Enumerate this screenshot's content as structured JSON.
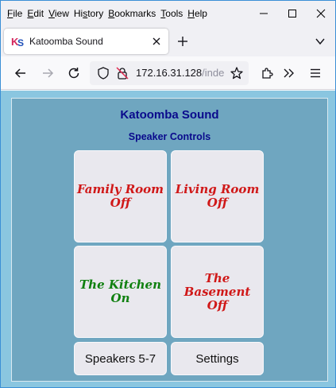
{
  "menubar": {
    "items": [
      {
        "first": "F",
        "rest": "ile"
      },
      {
        "first": "E",
        "rest": "dit"
      },
      {
        "first": "V",
        "rest": "iew"
      },
      {
        "first": "",
        "rest": "Hi",
        "u": "s",
        "tail": "tory"
      },
      {
        "first": "B",
        "rest": "ookmarks"
      },
      {
        "first": "T",
        "rest": "ools"
      },
      {
        "first": "H",
        "rest": "elp"
      }
    ]
  },
  "tab": {
    "favicon_text": "KS",
    "title": "Katoomba Sound"
  },
  "urlbar": {
    "url_main": "172.16.31.128",
    "url_rest": "/inde"
  },
  "app": {
    "title": "Katoomba Sound",
    "subtitle": "Speaker Controls",
    "tiles": [
      {
        "line1": "Family Room",
        "line2": "Off",
        "state": "off"
      },
      {
        "line1": "Living Room",
        "line2": "Off",
        "state": "off"
      },
      {
        "line1": "The Kitchen",
        "line2": "On",
        "state": "on"
      },
      {
        "line1": "The Basement",
        "line2": "Off",
        "state": "off"
      }
    ],
    "buttons": {
      "speakers_label": "Speakers 5-7",
      "settings_label": "Settings"
    }
  },
  "colors": {
    "off": "#d01818",
    "on": "#108010",
    "title": "#0a0a8c",
    "panel": "#6fa6c0",
    "background": "#8ac6e0"
  }
}
